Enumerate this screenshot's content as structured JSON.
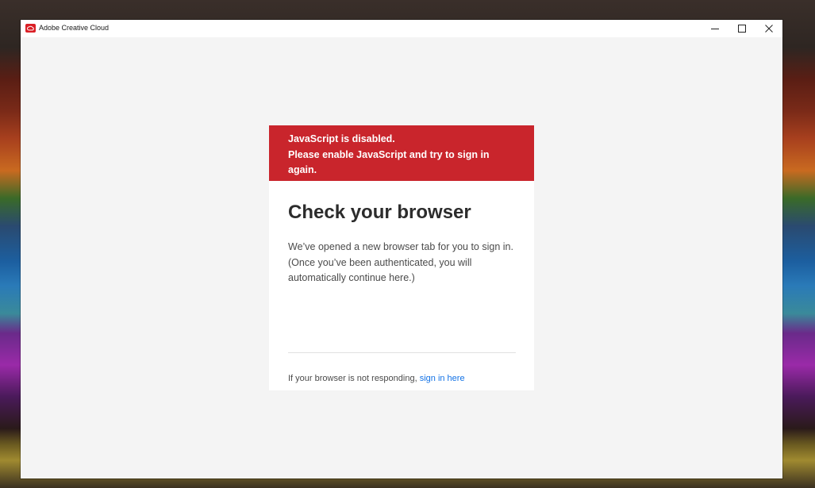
{
  "window": {
    "title": "Adobe Creative Cloud",
    "controls": {
      "minimize_icon": "minimize-icon",
      "maximize_icon": "maximize-icon",
      "close_icon": "close-icon"
    }
  },
  "card": {
    "error": {
      "text": "JavaScript is disabled.\nPlease enable JavaScript and try to sign in again.",
      "color": "#c9252c"
    },
    "title": "Check your browser",
    "body": "We’ve opened a new browser tab for you to sign in. (Once you’ve been authenticated, you will automatically continue here.)",
    "footer": {
      "prefix": "If your browser is not responding, ",
      "link": "sign in here",
      "link_color": "#1473e6"
    }
  }
}
